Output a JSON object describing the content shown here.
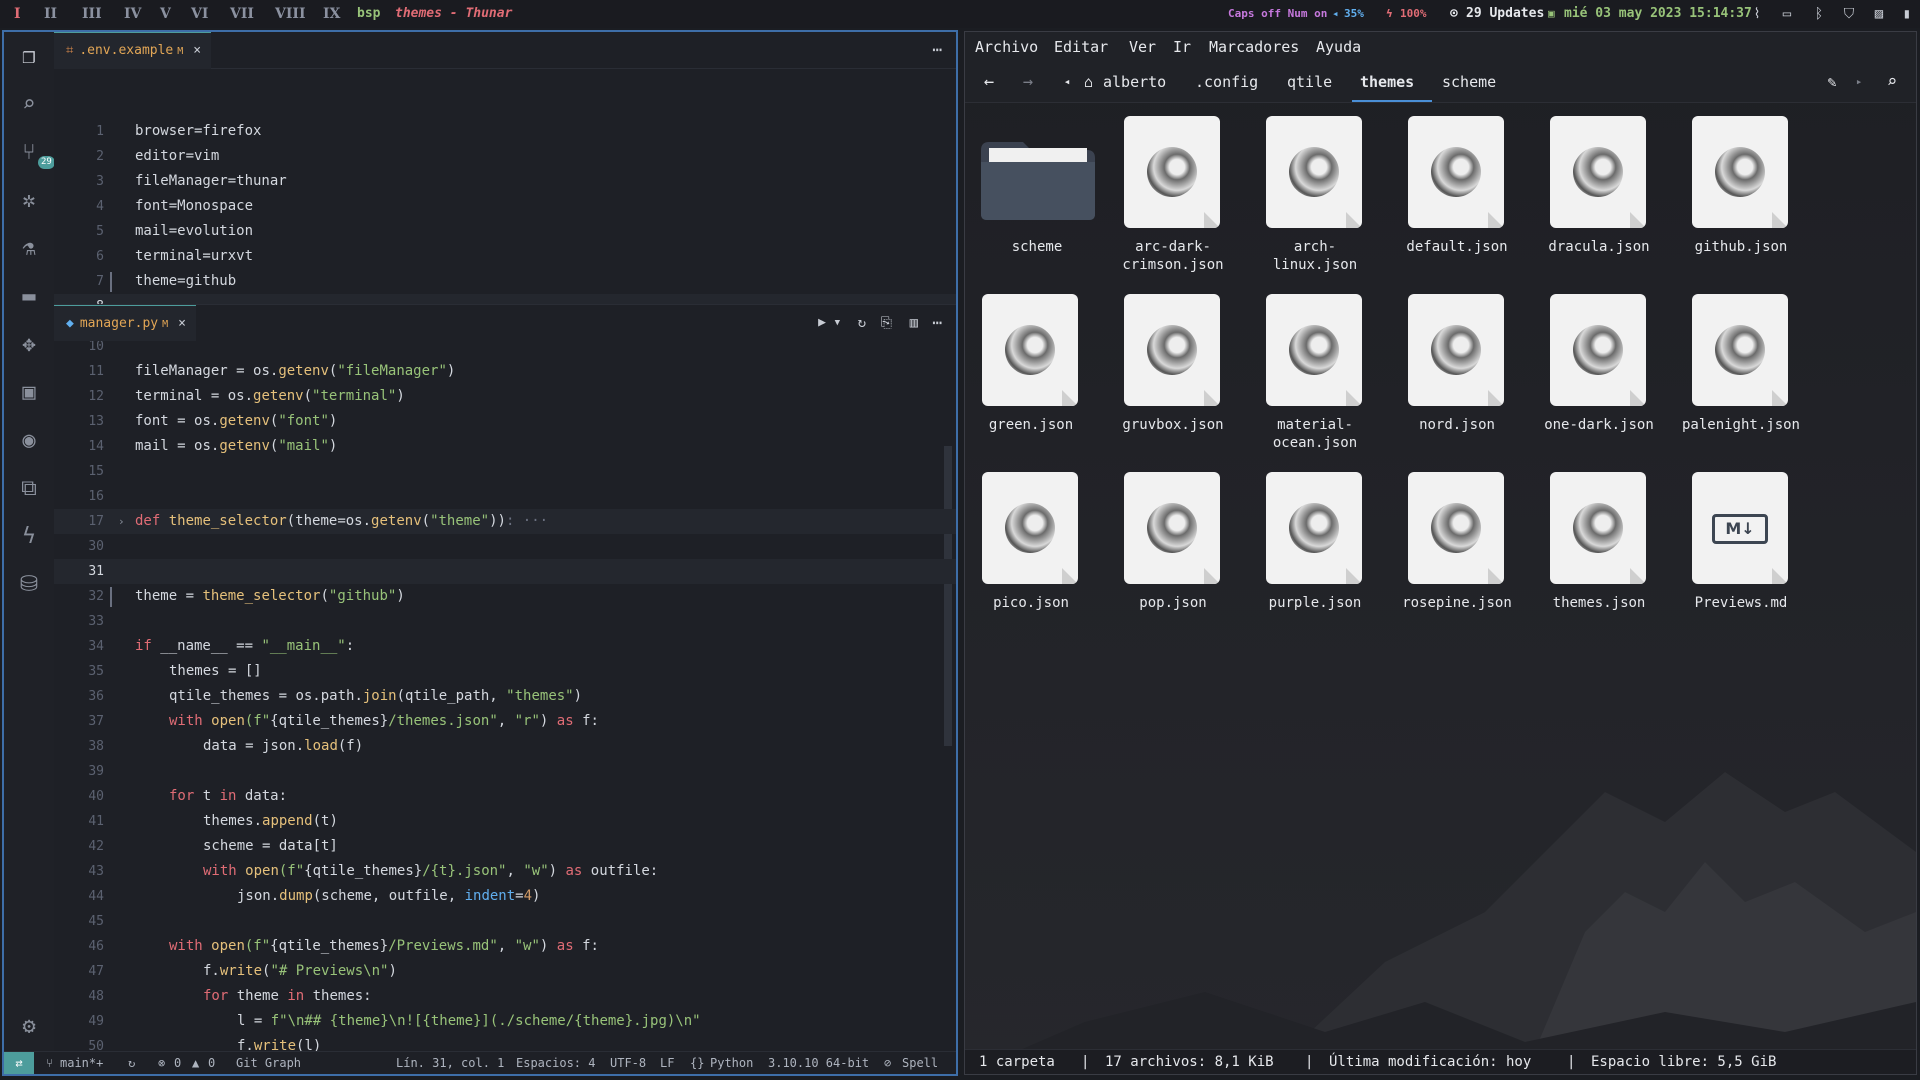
{
  "topbar": {
    "workspaces": [
      "I",
      "II",
      "III",
      "IV",
      "V",
      "VI",
      "VII",
      "VIII",
      "IX"
    ],
    "layout": "bsp",
    "window_title": "themes - Thunar",
    "caps": "Caps off Num on",
    "volume": "35%",
    "battery": "100%",
    "updates": "29 Updates",
    "datetime": "mié 03 may 2023 15:14:37",
    "colors": {
      "caps": "#c678dd",
      "volume": "#61afef",
      "battery": "#e06c75",
      "updates": "#e6e8ec",
      "date": "#98c379"
    }
  },
  "vscode": {
    "scm_badge": "29",
    "tab1": {
      "name": ".env.example",
      "mod": "M",
      "close": "×"
    },
    "env_lines": [
      {
        "n": "1",
        "t": "browser=firefox"
      },
      {
        "n": "2",
        "t": "editor=vim"
      },
      {
        "n": "3",
        "t": "fileManager=thunar"
      },
      {
        "n": "4",
        "t": "font=Monospace"
      },
      {
        "n": "5",
        "t": "mail=evolution"
      },
      {
        "n": "6",
        "t": "terminal=urxvt"
      },
      {
        "n": "7",
        "t": "theme=github"
      },
      {
        "n": "8",
        "t": ""
      }
    ],
    "tab2": {
      "name": "manager.py",
      "mod": "M",
      "close": "×"
    },
    "py_line_numbers": [
      "10",
      "11",
      "12",
      "13",
      "14",
      "15",
      "16",
      "17",
      "30",
      "31",
      "32",
      "33",
      "34",
      "35",
      "36",
      "37",
      "38",
      "39",
      "40",
      "41",
      "42",
      "43",
      "44",
      "45",
      "46",
      "47",
      "48",
      "49",
      "50"
    ],
    "py": {
      "l11": [
        "fileManager",
        " = ",
        "os",
        ".",
        "getenv",
        "(",
        "\"fileManager\"",
        ")"
      ],
      "l12": [
        "terminal",
        " = ",
        "os",
        ".",
        "getenv",
        "(",
        "\"terminal\"",
        ")"
      ],
      "l13": [
        "font",
        " = ",
        "os",
        ".",
        "getenv",
        "(",
        "\"font\"",
        ")"
      ],
      "l14": [
        "mail",
        " = ",
        "os",
        ".",
        "getenv",
        "(",
        "\"mail\"",
        ")"
      ],
      "l17": [
        "def",
        " ",
        "theme_selector",
        "(theme=os.",
        "getenv",
        "(",
        "\"theme\"",
        "))",
        ": ···"
      ],
      "l32": [
        "theme",
        " = ",
        "theme_selector",
        "(",
        "\"github\"",
        ")"
      ],
      "l34": [
        "if",
        " __name__ == ",
        "\"__main__\"",
        ":"
      ],
      "l35": "themes = []",
      "l36": [
        "qtile_themes",
        " = os.path.",
        "join",
        "(qtile_path, ",
        "\"themes\"",
        ")"
      ],
      "l37": [
        "with",
        " ",
        "open",
        "(f\"",
        "{qtile_themes}",
        "/themes.json\"",
        ", ",
        "\"r\"",
        ") ",
        "as",
        " f:"
      ],
      "l38": [
        "data",
        " = json.",
        "load",
        "(f)"
      ],
      "l40": [
        "for",
        " t ",
        "in",
        " data:"
      ],
      "l41": [
        "themes.",
        "append",
        "(t)"
      ],
      "l42": "scheme = data[t]",
      "l43": [
        "with",
        " ",
        "open",
        "(f\"",
        "{qtile_themes}",
        "/{t}.json\"",
        ", ",
        "\"w\"",
        ") ",
        "as",
        " outfile:"
      ],
      "l44": [
        "json.",
        "dump",
        "(scheme, outfile, ",
        "indent",
        "=",
        "4",
        ")"
      ],
      "l46": [
        "with",
        " ",
        "open",
        "(f\"",
        "{qtile_themes}",
        "/Previews.md\"",
        ", ",
        "\"w\"",
        ") ",
        "as",
        " f:"
      ],
      "l47": [
        "f.",
        "write",
        "(",
        "\"# Previews\\n\"",
        ")"
      ],
      "l48": [
        "for",
        " theme ",
        "in",
        " themes:"
      ],
      "l49": [
        "l = ",
        "f\"\\n## {theme}\\n![{theme}](./scheme/{theme}.jpg)\\n\""
      ],
      "l50": [
        "f.",
        "write",
        "(l)"
      ]
    },
    "status": {
      "branch": "main*+",
      "errors": "0",
      "warnings": "0",
      "git_graph": "Git Graph",
      "position": "Lín. 31, col. 1",
      "spaces": "Espacios: 4",
      "encoding": "UTF-8",
      "eol": "LF",
      "language": "Python",
      "interpreter": "3.10.10 64-bit",
      "spell": "Spell"
    }
  },
  "thunar": {
    "menu": [
      "Archivo",
      "Editar",
      "Ver",
      "Ir",
      "Marcadores",
      "Ayuda"
    ],
    "path": {
      "home": "alberto",
      "p1": ".config",
      "p2": "qtile",
      "current": "themes",
      "p3": "scheme"
    },
    "files": [
      {
        "name": "scheme",
        "type": "folder"
      },
      {
        "name": "arc-dark-crimson.json",
        "type": "json",
        "label1": "arc-dark-",
        "label2": "crimson.json"
      },
      {
        "name": "arch-linux.json",
        "type": "json",
        "label1": "arch-",
        "label2": "linux.json"
      },
      {
        "name": "default.json",
        "type": "json"
      },
      {
        "name": "dracula.json",
        "type": "json"
      },
      {
        "name": "github.json",
        "type": "json"
      },
      {
        "name": "green.json",
        "type": "json"
      },
      {
        "name": "gruvbox.json",
        "type": "json"
      },
      {
        "name": "material-ocean.json",
        "type": "json",
        "label1": "material-",
        "label2": "ocean.json"
      },
      {
        "name": "nord.json",
        "type": "json"
      },
      {
        "name": "one-dark.json",
        "type": "json"
      },
      {
        "name": "palenight.json",
        "type": "json"
      },
      {
        "name": "pico.json",
        "type": "json"
      },
      {
        "name": "pop.json",
        "type": "json"
      },
      {
        "name": "purple.json",
        "type": "json"
      },
      {
        "name": "rosepine.json",
        "type": "json"
      },
      {
        "name": "themes.json",
        "type": "json"
      },
      {
        "name": "Previews.md",
        "type": "md"
      }
    ],
    "md_glyph": "M↓",
    "status": {
      "folders": "1 carpeta",
      "files": "17 archivos: 8,1 KiB",
      "modified": "Última modificación: hoy",
      "free": "Espacio libre: 5,5 GiB"
    }
  }
}
